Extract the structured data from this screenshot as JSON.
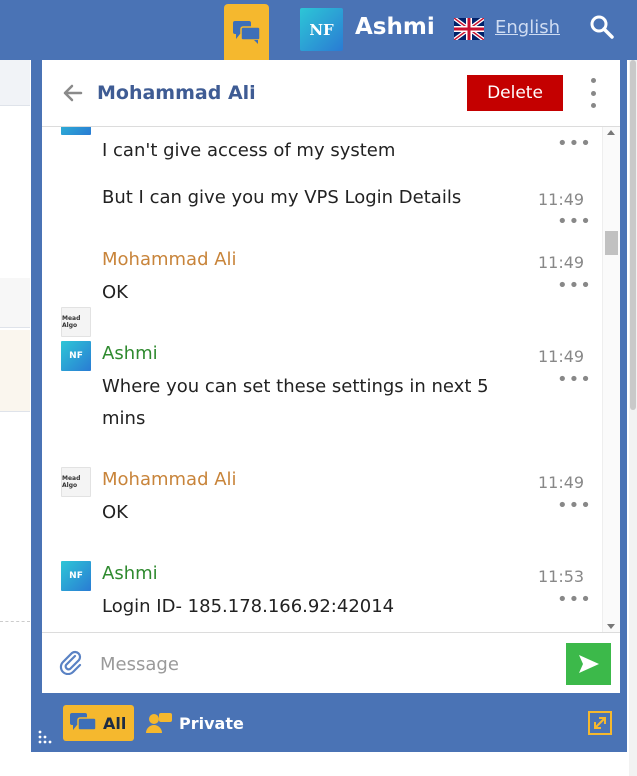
{
  "header": {
    "user_name": "Ashmi",
    "language": "English",
    "avatar_text": "NF",
    "icons": {
      "chat": "chat-bubbles-icon",
      "flag": "uk-flag-icon",
      "search": "search-icon"
    }
  },
  "chat": {
    "title": "Mohammad Ali",
    "delete_label": "Delete",
    "messages": [
      {
        "text": "I can't give access of my system",
        "time": ""
      },
      {
        "text": "But I can give you my VPS Login Details",
        "time": "11:49"
      },
      {
        "sender": "Mohammad Ali",
        "text": "OK",
        "time": "11:49",
        "avatar_text": "Mead Algo"
      },
      {
        "sender": "Ashmi",
        "text": "Where you can set these settings in next 5 mins",
        "time": "11:49",
        "avatar_text": "NF"
      },
      {
        "sender": "Mohammad Ali",
        "text": "OK",
        "time": "11:49",
        "avatar_text": "Mead Algo"
      },
      {
        "sender": "Ashmi",
        "text": "Login ID- 185.178.166.92:42014",
        "time": "11:53",
        "avatar_text": "NF"
      }
    ],
    "more_glyph": "•••",
    "composer": {
      "placeholder": "Message"
    }
  },
  "footer": {
    "filter_all_label": "All",
    "filter_private_label": "Private"
  },
  "colors": {
    "header_bg": "#4a73b5",
    "accent_yellow": "#f5b82e",
    "delete_red": "#c40000",
    "send_green": "#3cb94a",
    "title_blue": "#3f5c94",
    "ali_name": "#c8843a",
    "ashmi_name": "#2f8a2f"
  }
}
